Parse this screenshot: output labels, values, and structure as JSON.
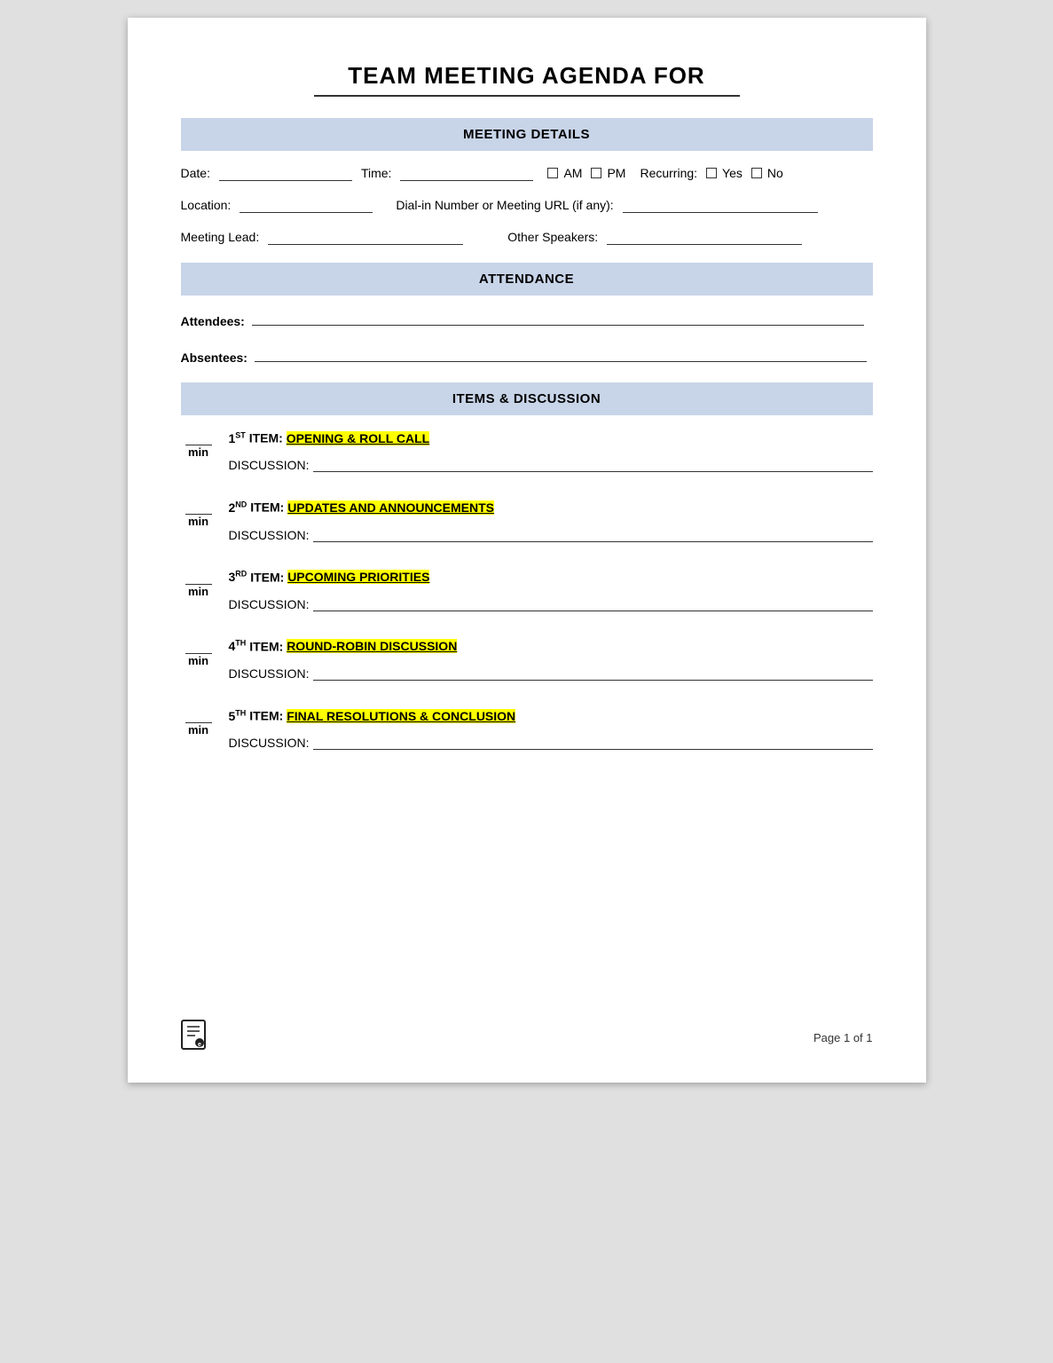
{
  "title": "TEAM MEETING AGENDA FOR",
  "sections": {
    "details": {
      "header": "MEETING DETAILS",
      "date_label": "Date:",
      "time_label": "Time:",
      "am_label": "AM",
      "pm_label": "PM",
      "recurring_label": "Recurring:",
      "yes_label": "Yes",
      "no_label": "No",
      "location_label": "Location:",
      "dialin_label": "Dial-in Number or Meeting URL (if any):",
      "meeting_lead_label": "Meeting Lead:",
      "other_speakers_label": "Other Speakers:"
    },
    "attendance": {
      "header": "ATTENDANCE",
      "attendees_label": "Attendees:",
      "absentees_label": "Absentees:"
    },
    "items": {
      "header": "ITEMS & DISCUSSION",
      "agenda_items": [
        {
          "number": "1",
          "ordinal": "ST",
          "title_prefix": "ITEM:",
          "title_name": "OPENING & ROLL CALL",
          "discussion_label": "DISCUSSION:"
        },
        {
          "number": "2",
          "ordinal": "ND",
          "title_prefix": "ITEM:",
          "title_name": "UPDATES AND ANNOUNCEMENTS",
          "discussion_label": "DISCUSSION:"
        },
        {
          "number": "3",
          "ordinal": "RD",
          "title_prefix": "ITEM:",
          "title_name": "UPCOMING PRIORITIES",
          "discussion_label": "DISCUSSION:"
        },
        {
          "number": "4",
          "ordinal": "TH",
          "title_prefix": "ITEM:",
          "title_name": "ROUND-ROBIN DISCUSSION",
          "discussion_label": "DISCUSSION:"
        },
        {
          "number": "5",
          "ordinal": "TH",
          "title_prefix": "ITEM:",
          "title_name": "FINAL RESOLUTIONS & CONCLUSION",
          "discussion_label": "DISCUSSION:"
        }
      ]
    }
  },
  "footer": {
    "page_label": "Page 1 of 1"
  }
}
